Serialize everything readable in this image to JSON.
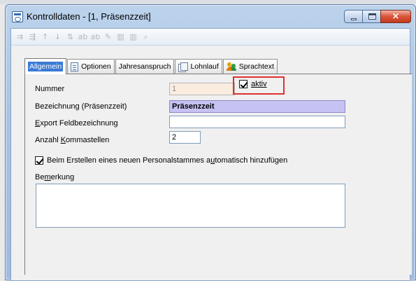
{
  "window": {
    "title": "Kontrolldaten - [1, Präsenzzeit]",
    "close_glyph": "×"
  },
  "toolbar": {
    "icons": [
      "insert-row-icon",
      "delete-row-icon",
      "arrow-up-icon",
      "arrow-down-icon",
      "sort-icon",
      "spellcheck-icon",
      "spellcheck-all-icon",
      "edit-icon",
      "columns-icon",
      "columns-2-icon",
      "search-icon"
    ],
    "glyphs": [
      "⇉",
      "⇶",
      "↑",
      "↓",
      "⇅",
      "ab",
      "ab",
      "✎",
      "▥",
      "▥",
      "⌕"
    ]
  },
  "tabs": [
    {
      "label": "Allgemein",
      "icon": "",
      "active": true
    },
    {
      "label": "Optionen",
      "icon": "document-icon",
      "active": false
    },
    {
      "label": "Jahresanspruch",
      "icon": "",
      "active": false
    },
    {
      "label": "Lohnlauf",
      "icon": "pages-icon",
      "active": false
    },
    {
      "label": "Sprachtext",
      "icon": "people-icon",
      "active": false
    }
  ],
  "form": {
    "nummer_label": "Nummer",
    "nummer_value": "1",
    "aktiv_label": "aktiv",
    "aktiv_checked": true,
    "bezeichnung_label": "Bezeichnung (Präsenzzeit)",
    "bezeichnung_value": "Präsenzzeit",
    "export_label_pre": "",
    "export_label_u": "E",
    "export_label_post": "xport Feldbezeichnung",
    "export_value": "",
    "komma_label_pre": "Anzahl ",
    "komma_label_u": "K",
    "komma_label_post": "ommastellen",
    "komma_value": "2",
    "auto_label_pre": "Beim Erstellen eines neuen Personalstammes a",
    "auto_label_u": "u",
    "auto_label_post": "tomatisch hinzufügen",
    "auto_checked": true,
    "bemerkung_label_pre": "Be",
    "bemerkung_label_u": "m",
    "bemerkung_label_post": "erkung",
    "bemerkung_value": ""
  },
  "colors": {
    "highlight_field": "#c6c2f2",
    "disabled_field": "#fbece0",
    "annotation_box": "#e03030",
    "active_tab": "#3a7bd5"
  }
}
